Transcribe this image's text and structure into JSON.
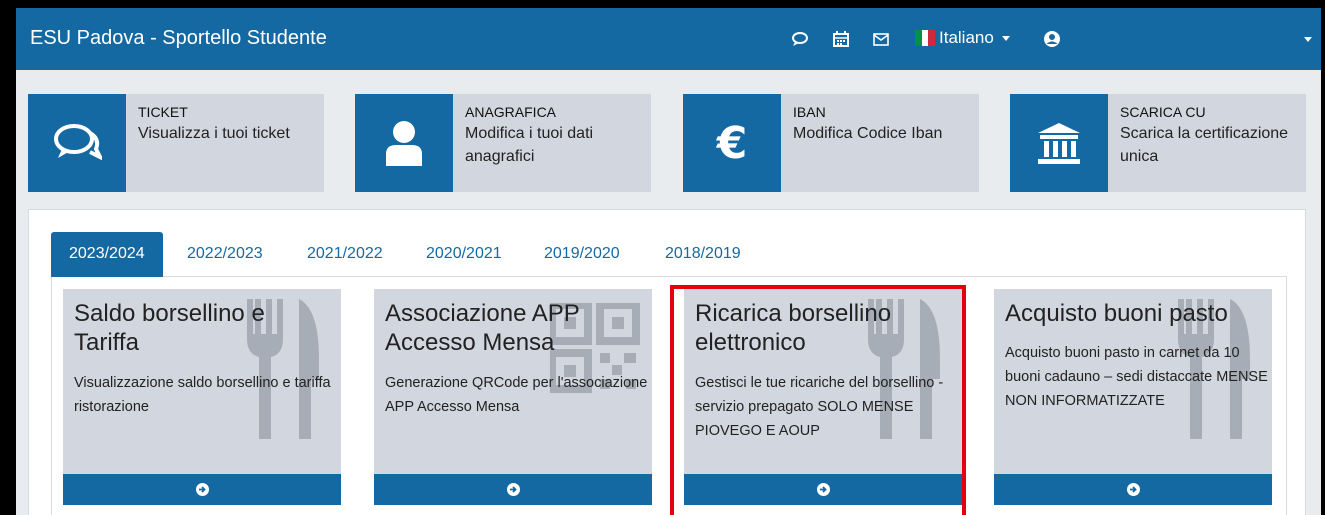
{
  "navbar": {
    "brand": "ESU Padova - Sportello Studente",
    "language": "Italiano",
    "icons": [
      "chat-icon",
      "calendar-icon",
      "mail-icon",
      "user-icon"
    ],
    "color": "#1569a2"
  },
  "tiles": [
    {
      "title": "TICKET",
      "subtitle": "Visualizza i tuoi ticket",
      "icon": "comments-icon"
    },
    {
      "title": "ANAGRAFICA",
      "subtitle": "Modifica i tuoi dati anagrafici",
      "icon": "user-icon"
    },
    {
      "title": "IBAN",
      "subtitle": "Modifica Codice Iban",
      "icon": "euro-icon"
    },
    {
      "title": "SCARICA CU",
      "subtitle": "Scarica la certificazione unica",
      "icon": "bank-icon"
    }
  ],
  "tabs": [
    "2023/2024",
    "2022/2023",
    "2021/2022",
    "2020/2021",
    "2019/2020",
    "2018/2019"
  ],
  "active_tab": "2023/2024",
  "cards": [
    {
      "title": "Saldo borsellino e Tariffa",
      "desc": "Visualizzazione saldo borsellino e tariffa ristorazione",
      "icon": "cutlery-icon"
    },
    {
      "title": "Associazione APP Accesso Mensa",
      "desc": "Generazione QRCode per l'associazione APP Accesso Mensa",
      "icon": "qrcode-icon"
    },
    {
      "title": "Ricarica borsellino elettronico",
      "desc": "Gestisci le tue ricariche del borsellino - servizio prepagato SOLO MENSE PIOVEGO E AOUP",
      "icon": "cutlery-icon"
    },
    {
      "title": "Acquisto buoni pasto",
      "desc": "Acquisto buoni pasto in carnet da 10 buoni cadauno – sedi distaccate MENSE NON INFORMATIZZATE",
      "icon": "cutlery-icon"
    }
  ],
  "highlight_color": "#e3000f"
}
